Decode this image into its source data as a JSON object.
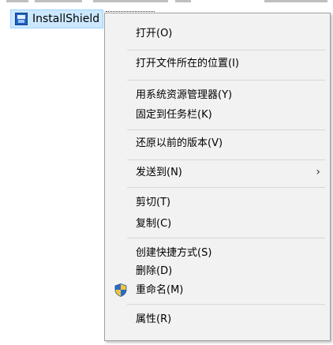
{
  "explorer": {
    "selected_item": "InstallShield",
    "icon": "installshield-icon"
  },
  "menu": {
    "items": [
      {
        "label": "打开(O)"
      },
      {
        "label": "打开文件所在的位置(I)"
      },
      {
        "label": "用系统资源管理器(Y)"
      },
      {
        "label": "固定到任务栏(K)"
      },
      {
        "label": "还原以前的版本(V)"
      },
      {
        "label": "发送到(N)",
        "submenu": true
      },
      {
        "label": "剪切(T)"
      },
      {
        "label": "复制(C)"
      },
      {
        "label": "创建快捷方式(S)"
      },
      {
        "label": "删除(D)"
      },
      {
        "label": "重命名(M)",
        "icon": "shield-icon"
      },
      {
        "label": "属性(R)"
      }
    ],
    "submenu_arrow": "›"
  },
  "colors": {
    "menu_bg": "#f2f2f2",
    "selection_bg": "#cce8ff",
    "shield_blue": "#2b6cc4",
    "shield_gold": "#f3c33c"
  }
}
